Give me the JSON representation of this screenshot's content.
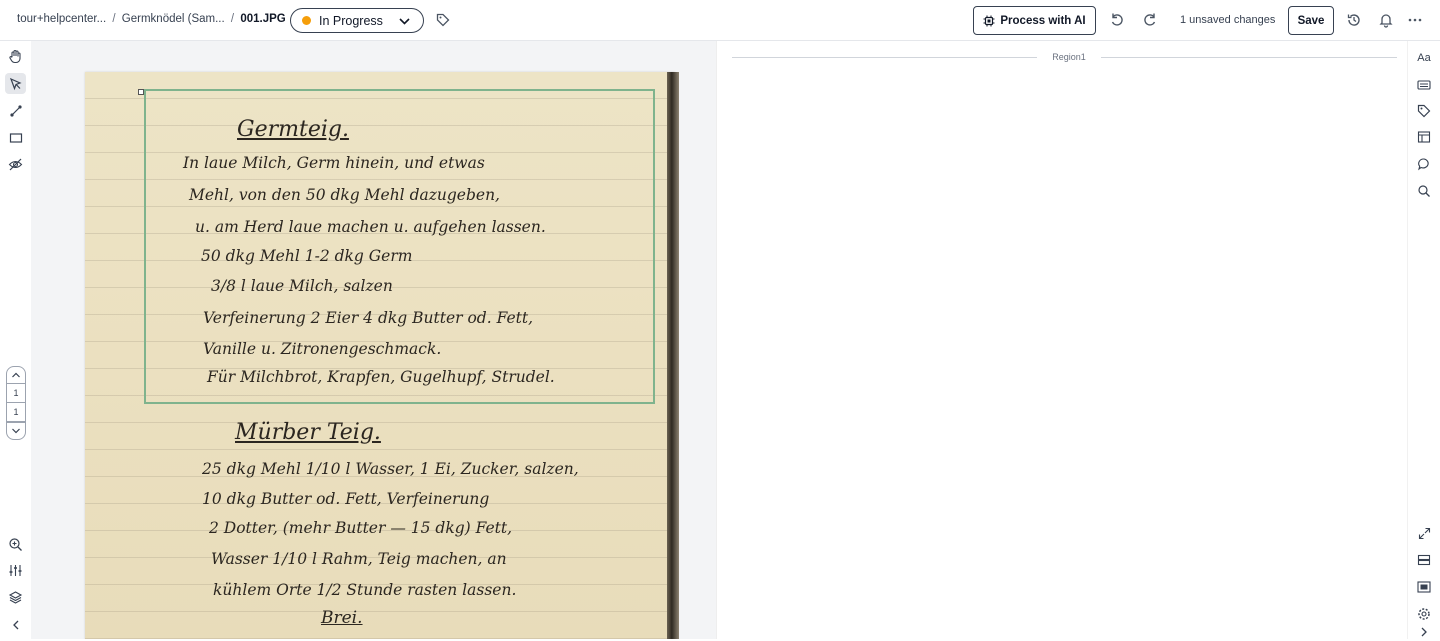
{
  "breadcrumb": {
    "part1": "tour+helpcenter...",
    "sep1": "/",
    "part2": "Germknödel (Sam...",
    "sep2": "/",
    "current": "001.JPG"
  },
  "status": {
    "label": "In Progress",
    "color": "#f59e0b"
  },
  "toolbar": {
    "process_ai_label": "Process with AI",
    "unsaved_text": "1 unsaved changes",
    "save_label": "Save"
  },
  "pager": {
    "current_page": "1",
    "total_pages": "1"
  },
  "region_panel": {
    "region_label": "Region1"
  },
  "right_tools": {
    "text_style_label": "Aa"
  },
  "document": {
    "title1": "Germteig.",
    "lines1": [
      "In laue Milch, Germ hinein, und etwas",
      "Mehl, von den 50 dkg Mehl dazugeben,",
      "u. am Herd laue machen u. aufgehen lassen.",
      "50 dkg Mehl 1-2 dkg Germ",
      "3/8 l laue Milch, salzen",
      "Verfeinerung 2 Eier 4 dkg Butter od. Fett,",
      "Vanille u. Zitronengeschmack.",
      "Für Milchbrot, Krapfen, Gugelhupf, Strudel."
    ],
    "title2": "Mürber Teig.",
    "lines2": [
      "25 dkg Mehl 1/10 l Wasser, 1 Ei, Zucker, salzen,",
      "10 dkg Butter od. Fett, Verfeinerung",
      "2 Dotter, (mehr Butter — 15 dkg) Fett,",
      "Wasser 1/10 l Rahm, Teig machen, an",
      "kühlem Orte 1/2 Stunde rasten lassen."
    ],
    "title3": "Brei."
  },
  "icons": {
    "left": [
      "hand-icon",
      "pointer-icon",
      "line-icon",
      "rectangle-icon",
      "eye-off-icon",
      "zoom-in-icon",
      "sliders-icon",
      "layers-icon",
      "collapse-left-icon"
    ],
    "top": [
      "tag-icon",
      "chip-icon",
      "undo-icon",
      "redo-icon",
      "history-icon",
      "bell-icon",
      "more-icon"
    ],
    "right": [
      "text-style-icon",
      "keyboard-icon",
      "tag-icon",
      "layout-icon",
      "comment-icon",
      "search-icon",
      "expand-icon",
      "rows-icon",
      "panel-icon",
      "settings-icon",
      "expand-right-icon"
    ]
  }
}
